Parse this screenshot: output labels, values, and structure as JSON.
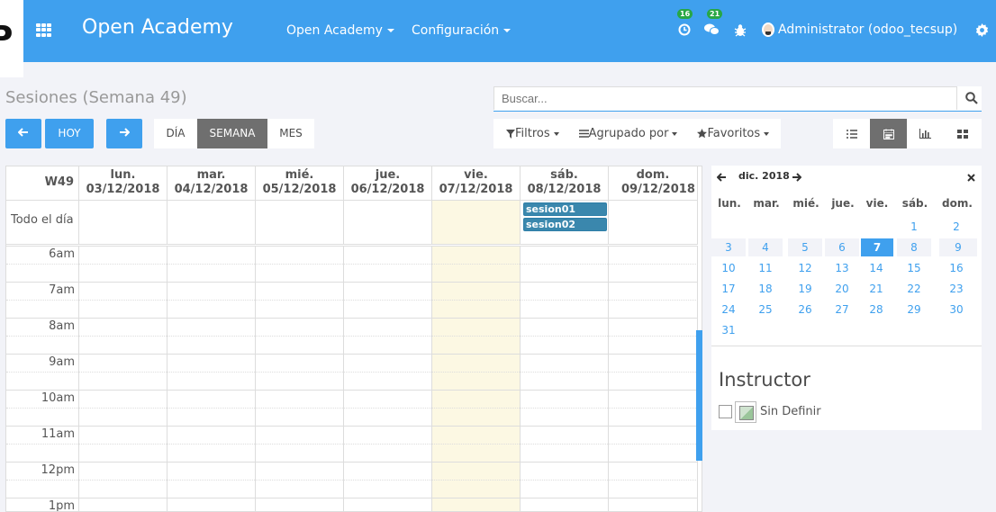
{
  "topbar": {
    "logo_text": "P",
    "brand": "Open Academy",
    "menus": [
      "Open Academy",
      "Configuración"
    ],
    "activity_count": "16",
    "messages_count": "21",
    "user": "Administrator (odoo_tecsup)",
    "accent": "#3fa0ee"
  },
  "page": {
    "title": "Sesiones (Semana 49)",
    "search_placeholder": "Buscar...",
    "today_label": "HOY",
    "modes": [
      "DÍA",
      "SEMANA",
      "MES"
    ],
    "active_mode": "SEMANA",
    "filters": [
      "Filtros",
      "Agrupado por",
      "Favoritos"
    ],
    "views": [
      "list-icon",
      "calendar-icon",
      "graph-icon",
      "kanban-icon"
    ],
    "active_view": "calendar-icon"
  },
  "calendar": {
    "week_label": "W49",
    "days": [
      "lun. 03/12/2018",
      "mar. 04/12/2018",
      "mié. 05/12/2018",
      "jue. 06/12/2018",
      "vie. 07/12/2018",
      "sáb. 08/12/2018",
      "dom. 09/12/2018"
    ],
    "all_day_label": "Todo el día",
    "events": [
      "sesion01",
      "sesion02"
    ],
    "hours": [
      "6am",
      "7am",
      "8am",
      "9am",
      "10am",
      "11am",
      "12pm",
      "1pm"
    ]
  },
  "mini_calendar": {
    "month": "dic. 2018",
    "day_names": [
      "lun.",
      "mar.",
      "mié.",
      "jue.",
      "vie.",
      "sáb.",
      "dom."
    ],
    "weeks": [
      [
        "",
        "",
        "",
        "",
        "",
        "1",
        "2"
      ],
      [
        "3",
        "4",
        "5",
        "6",
        "7",
        "8",
        "9"
      ],
      [
        "10",
        "11",
        "12",
        "13",
        "14",
        "15",
        "16"
      ],
      [
        "17",
        "18",
        "19",
        "20",
        "21",
        "22",
        "23"
      ],
      [
        "24",
        "25",
        "26",
        "27",
        "28",
        "29",
        "30"
      ],
      [
        "31",
        "",
        "",
        "",
        "",
        "",
        ""
      ]
    ],
    "selected": "7"
  },
  "filter_panel": {
    "title": "Instructor",
    "option": "Sin Definir"
  }
}
